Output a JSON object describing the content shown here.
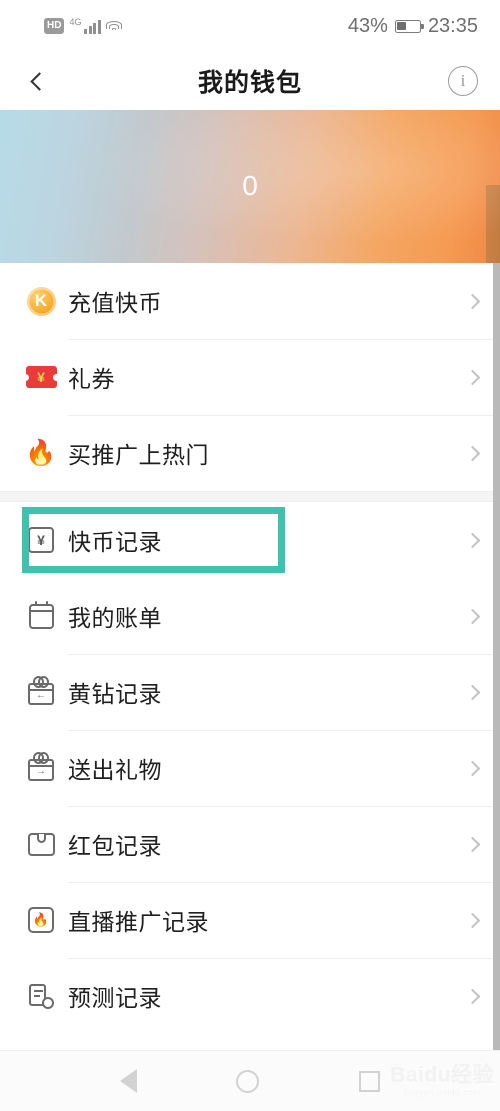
{
  "status_bar": {
    "hd_label": "HD",
    "network_label": "4G",
    "signal_icon": "signal-bars-icon",
    "wifi_icon": "wifi-icon",
    "battery_percent": "43%",
    "battery_level": 43,
    "time": "23:35"
  },
  "header": {
    "back_icon": "chevron-left-icon",
    "title": "我的钱包",
    "info_icon": "info-circle-icon"
  },
  "banner": {
    "balance": "0",
    "gradient_from": "#b6dbe8",
    "gradient_to": "#ef8744",
    "edge_color": "#c67f46"
  },
  "highlight": {
    "color": "#3ec2ad",
    "target_label": "快币记录"
  },
  "list": {
    "groups": [
      {
        "items": [
          {
            "label": "充值快币",
            "icon": "k-coin-icon",
            "arrow": "chevron-right-icon"
          },
          {
            "label": "礼券",
            "icon": "voucher-ticket-icon",
            "arrow": "chevron-right-icon"
          },
          {
            "label": "买推广上热门",
            "icon": "flame-icon",
            "arrow": "chevron-right-icon"
          }
        ]
      },
      {
        "items": [
          {
            "label": "快币记录",
            "icon": "yuan-note-icon",
            "arrow": "chevron-right-icon",
            "highlighted": true
          },
          {
            "label": "我的账单",
            "icon": "calendar-icon",
            "arrow": "chevron-right-icon"
          },
          {
            "label": "黄钻记录",
            "icon": "gift-in-icon",
            "arrow": "chevron-right-icon"
          },
          {
            "label": "送出礼物",
            "icon": "gift-out-icon",
            "arrow": "chevron-right-icon"
          },
          {
            "label": "红包记录",
            "icon": "red-envelope-icon",
            "arrow": "chevron-right-icon"
          },
          {
            "label": "直播推广记录",
            "icon": "live-promo-icon",
            "arrow": "chevron-right-icon"
          },
          {
            "label": "预测记录",
            "icon": "forecast-record-icon",
            "arrow": "chevron-right-icon"
          }
        ]
      }
    ]
  },
  "nav_bar": {
    "back_icon": "nav-back-triangle-icon",
    "home_icon": "nav-home-circle-icon",
    "recents_icon": "nav-recents-square-icon"
  },
  "watermark": {
    "main": "Baidu经验",
    "sub": "jingyan.baidu.com"
  },
  "icon_glyphs": {
    "k_coin": "K",
    "yuan": "¥",
    "flame": "🔥",
    "info": "i",
    "gift_in": "←",
    "gift_out": "→"
  }
}
